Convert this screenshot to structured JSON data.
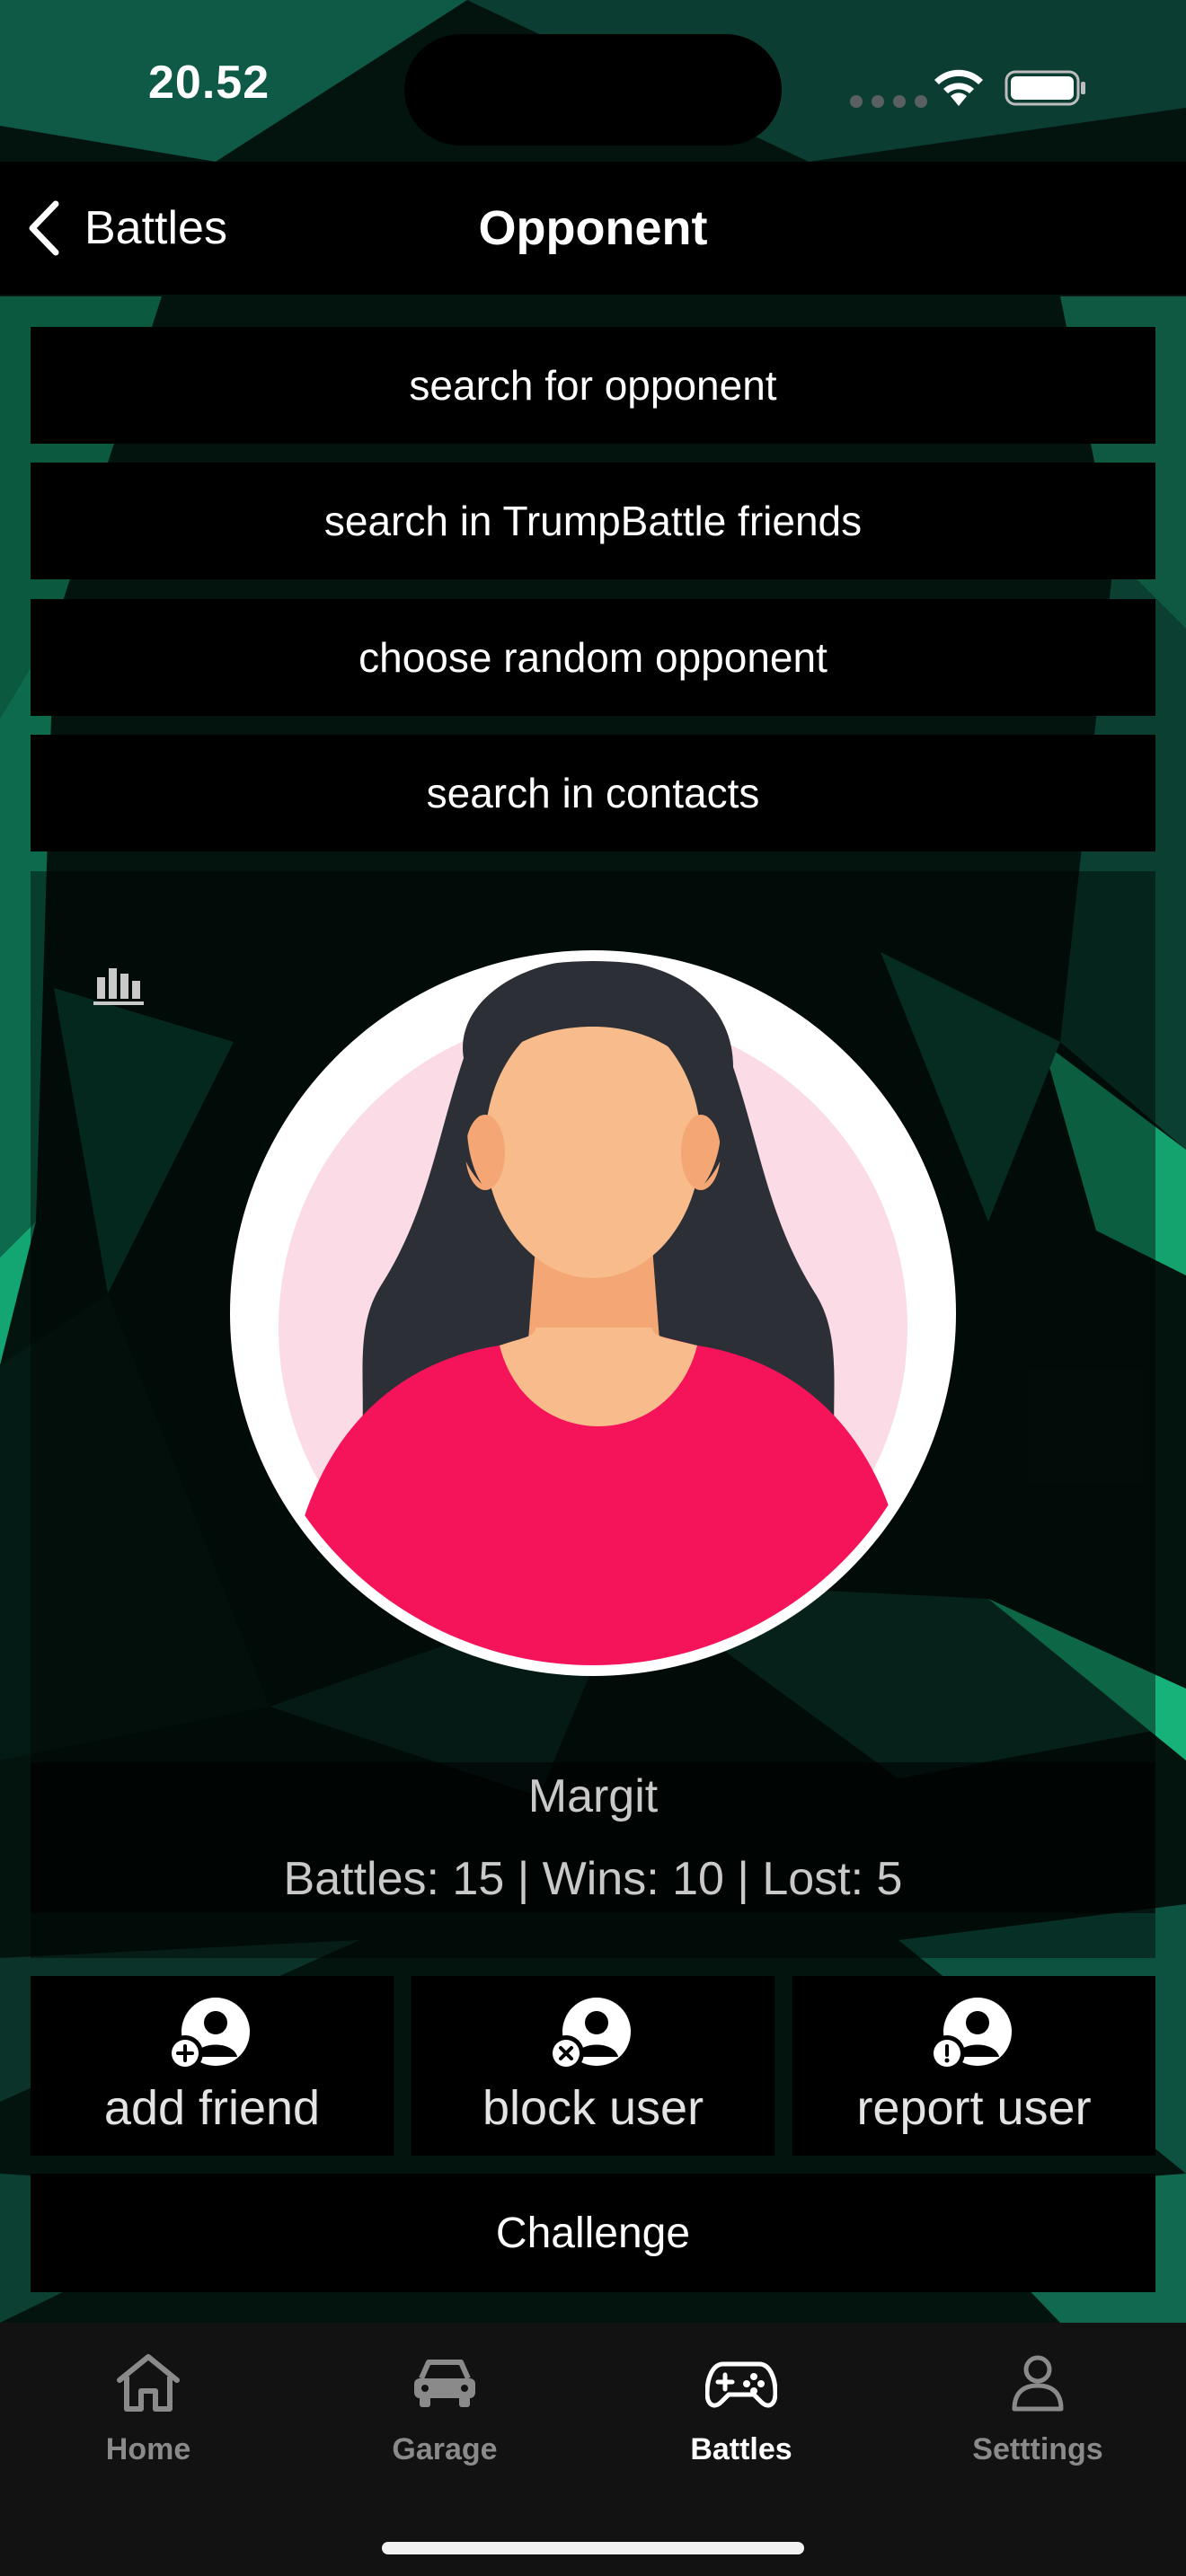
{
  "status_bar": {
    "time": "20.52"
  },
  "navbar": {
    "back_label": "Battles",
    "title": "Opponent"
  },
  "options": [
    {
      "label": "search for opponent"
    },
    {
      "label": "search in TrumpBattle friends"
    },
    {
      "label": "choose random opponent"
    },
    {
      "label": "search in contacts"
    }
  ],
  "profile": {
    "name": "Margit",
    "stats": "Battles: 15 | Wins: 10 | Lost: 5"
  },
  "actions": {
    "add_friend": "add friend",
    "block_user": "block user",
    "report_user": "report user"
  },
  "challenge_label": "Challenge",
  "tabs": [
    {
      "label": "Home",
      "icon": "home-icon"
    },
    {
      "label": "Garage",
      "icon": "car-icon"
    },
    {
      "label": "Battles",
      "icon": "gamepad-icon",
      "active": true
    },
    {
      "label": "Setttings",
      "icon": "person-icon"
    }
  ],
  "colors": {
    "accent_green": "#17a56d",
    "avatar_shirt": "#f5135a",
    "avatar_skin": "#f8bc8c"
  }
}
